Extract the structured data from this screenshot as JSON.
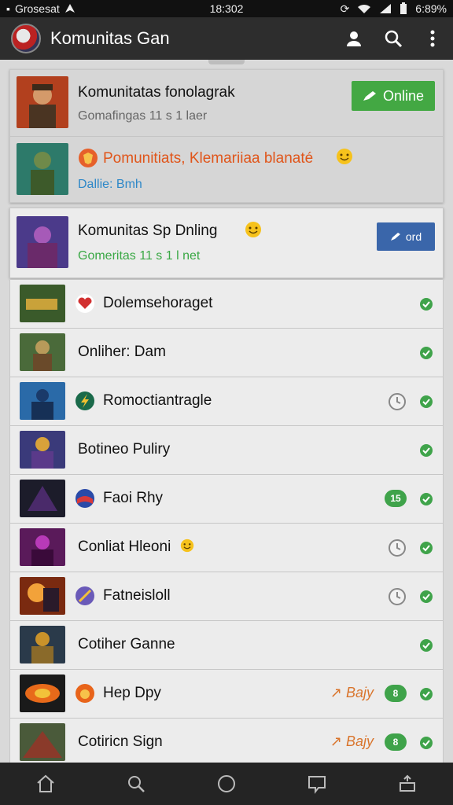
{
  "status": {
    "carrier": "Grosesat",
    "time": "18:302",
    "battery": "6:89%"
  },
  "app": {
    "title": "Komunitas Gan"
  },
  "featured": {
    "row1": {
      "title": "Komunitatas fonolagrak",
      "subtitle": "Gomafingas 11 s 1 laer",
      "button_label": "Online"
    },
    "row2": {
      "title": "Pomunitiats, Klemariiaa blanaté",
      "subtitle": "Dallie: Bmh"
    }
  },
  "second": {
    "title": "Komunitas Sp Dnling",
    "subtitle": "Gomeritas 11 s 1 l net",
    "button_label": "ord"
  },
  "list": [
    {
      "label": "Dolemsehoraget"
    },
    {
      "label": "Onliher: Dam"
    },
    {
      "label": "Romoctiantragle"
    },
    {
      "label": "Botineo Puliry"
    },
    {
      "label": "Faoi Rhy",
      "pill": "15"
    },
    {
      "label": "Conliat Hleoni"
    },
    {
      "label": "Fatneisloll"
    },
    {
      "label": "Cotiher Ganne"
    },
    {
      "label": "Hep Dpy",
      "tag": "Bajy",
      "pill": "8"
    },
    {
      "label": "Cotiricn Sign",
      "tag": "Bajy",
      "pill": "8"
    }
  ],
  "colors": {
    "accent_green": "#43a843",
    "accent_blue": "#3a66aa",
    "tag_orange": "#d9742b"
  }
}
